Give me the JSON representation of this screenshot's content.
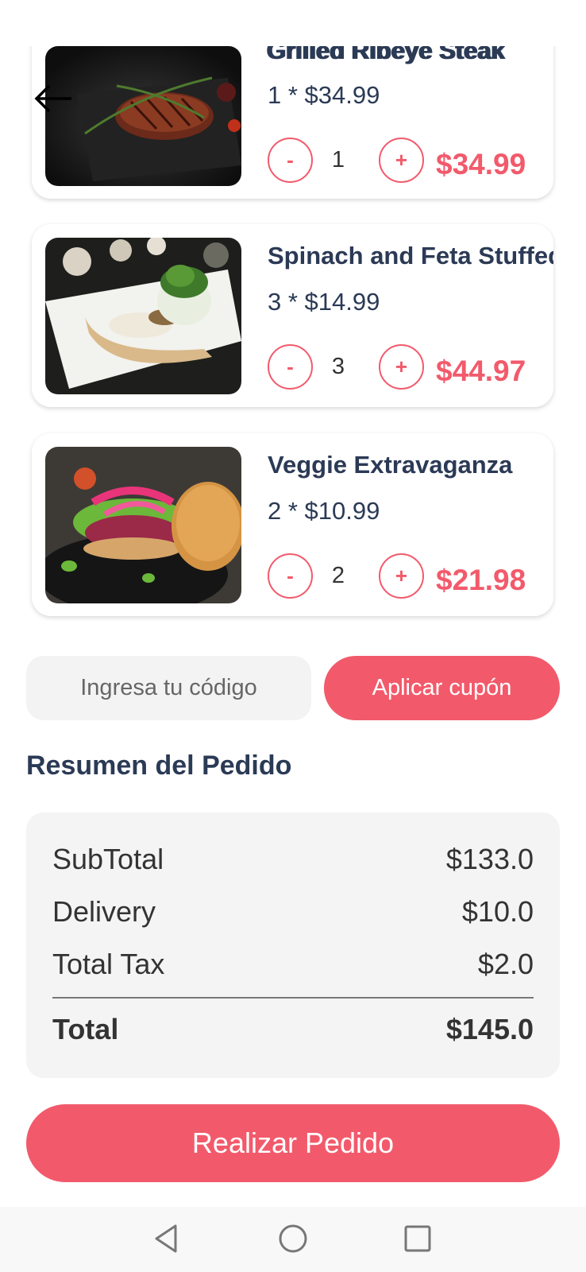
{
  "cart_items": [
    {
      "name": "Grilled Ribeye Steak",
      "unit": "1 * $34.99",
      "minus": "-",
      "qty": "1",
      "plus": "+",
      "total": "$34.99",
      "image_icon": "steak-photo"
    },
    {
      "name": "Spinach and Feta Stuffed",
      "unit": "3 * $14.99",
      "minus": "-",
      "qty": "3",
      "plus": "+",
      "total": "$44.97",
      "image_icon": "stuffed-chicken-photo"
    },
    {
      "name": "Veggie Extravaganza",
      "unit": "2 * $10.99",
      "minus": "-",
      "qty": "2",
      "plus": "+",
      "total": "$21.98",
      "image_icon": "veggie-burger-photo"
    }
  ],
  "coupon": {
    "placeholder": "Ingresa tu código",
    "button": "Aplicar cupón"
  },
  "summary": {
    "title": "Resumen del Pedido",
    "subtotal_label": "SubTotal",
    "subtotal_value": "$133.0",
    "delivery_label": "Delivery",
    "delivery_value": "$10.0",
    "tax_label": "Total Tax",
    "tax_value": "$2.0",
    "total_label": "Total",
    "total_value": "$145.0"
  },
  "order_button": "Realizar Pedido",
  "colors": {
    "accent": "#f25a6b",
    "text": "#2b3a55",
    "panel": "#f4f4f4"
  },
  "icons": {
    "back": "arrow-left-icon",
    "nav_back": "triangle-back-icon",
    "nav_home": "circle-home-icon",
    "nav_recent": "square-recent-icon"
  }
}
